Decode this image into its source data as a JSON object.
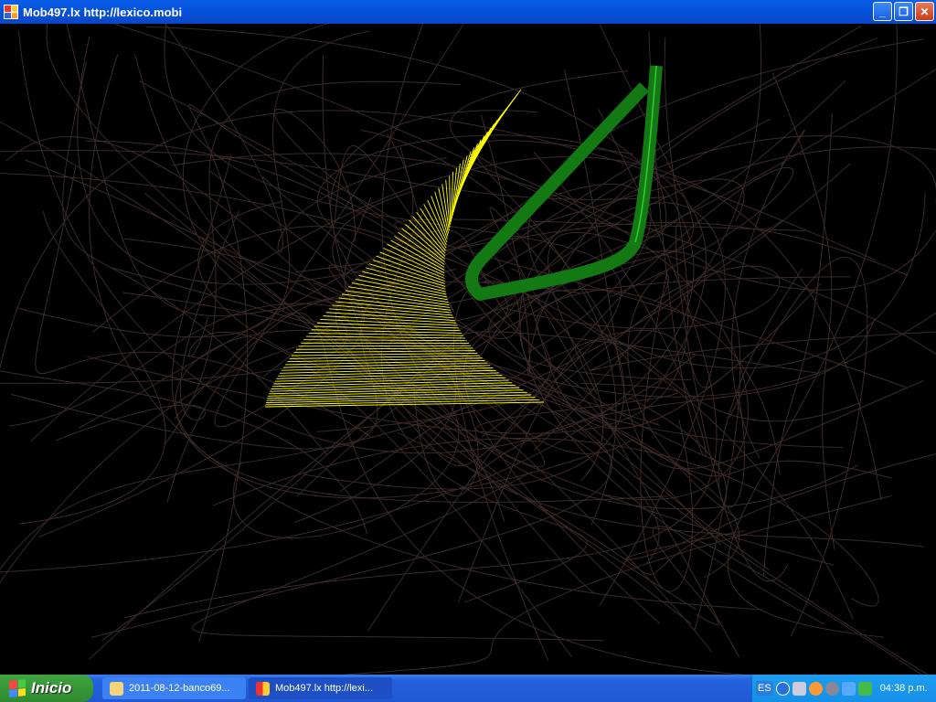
{
  "window": {
    "title": "Mob497.lx  http://lexico.mobi",
    "minimize_label": "_",
    "restore_label": "❐",
    "close_label": "✕"
  },
  "taskbar": {
    "start_label": "Inicio",
    "tasks": [
      {
        "label": "2011-08-12-banco69..."
      },
      {
        "label": "Mob497.lx  http://lexi..."
      }
    ],
    "tray": {
      "language": "ES",
      "clock": "04:38 p.m."
    }
  },
  "colors": {
    "surface": "#ffff00",
    "ribbon": "#1a8a1a",
    "curves": "#3a2a2a"
  }
}
